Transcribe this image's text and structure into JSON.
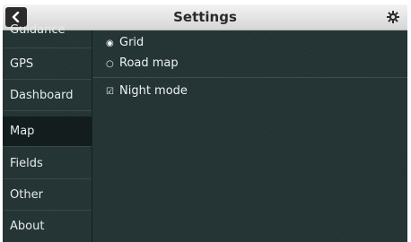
{
  "header": {
    "title": "Settings",
    "back_icon": "chevron-left-icon",
    "settings_icon": "gear-icon"
  },
  "sidebar": {
    "items": [
      {
        "label": "Guidance"
      },
      {
        "label": "GPS"
      },
      {
        "label": "Dashboard"
      },
      {
        "label": "Map"
      },
      {
        "label": "Fields"
      },
      {
        "label": "Other"
      },
      {
        "label": "About"
      }
    ],
    "selected": "Map"
  },
  "panel": {
    "map_type": {
      "options": [
        {
          "label": "Grid",
          "selected": true
        },
        {
          "label": "Road map",
          "selected": false
        }
      ]
    },
    "night_mode": {
      "label": "Night mode",
      "checked": true
    }
  }
}
